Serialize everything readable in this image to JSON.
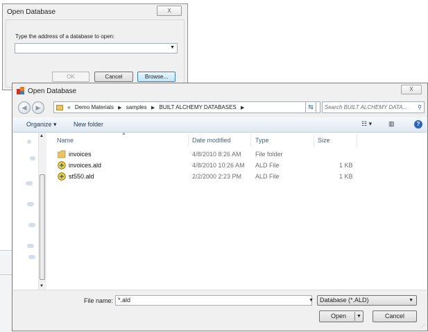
{
  "small_dialog": {
    "title": "Open Database",
    "close_label": "X",
    "prompt": "Type the address of a database to open:",
    "address_value": "",
    "ok_label": "OK",
    "cancel_label": "Cancel",
    "browse_label": "Browse..."
  },
  "main_dialog": {
    "title": "Open Database",
    "close_label": "X",
    "breadcrumb": [
      "«",
      "Demo Materials",
      "samples",
      "BUILT ALCHEMY DATABASES"
    ],
    "search_placeholder": "Search BUILT ALCHEMY DATA...",
    "toolbar": {
      "organize_label": "Organize ▾",
      "new_folder_label": "New folder"
    },
    "columns": {
      "name": "Name",
      "date": "Date modified",
      "type": "Type",
      "size": "Size"
    },
    "files": [
      {
        "icon": "folder-icon",
        "name": "invoices",
        "date": "4/8/2010 8:26 AM",
        "type": "File folder",
        "size": ""
      },
      {
        "icon": "ald-file-icon",
        "name": "invoices.ald",
        "date": "4/8/2010 10:26 AM",
        "type": "ALD File",
        "size": "1 KB"
      },
      {
        "icon": "ald-file-icon",
        "name": "st550.ald",
        "date": "2/2/2000 2:23 PM",
        "type": "ALD File",
        "size": "1 KB"
      }
    ],
    "footer": {
      "file_name_label": "File name:",
      "file_name_value": "*.ald",
      "file_type_value": "Database (*.ALD)",
      "open_label": "Open",
      "cancel_label": "Cancel"
    }
  }
}
